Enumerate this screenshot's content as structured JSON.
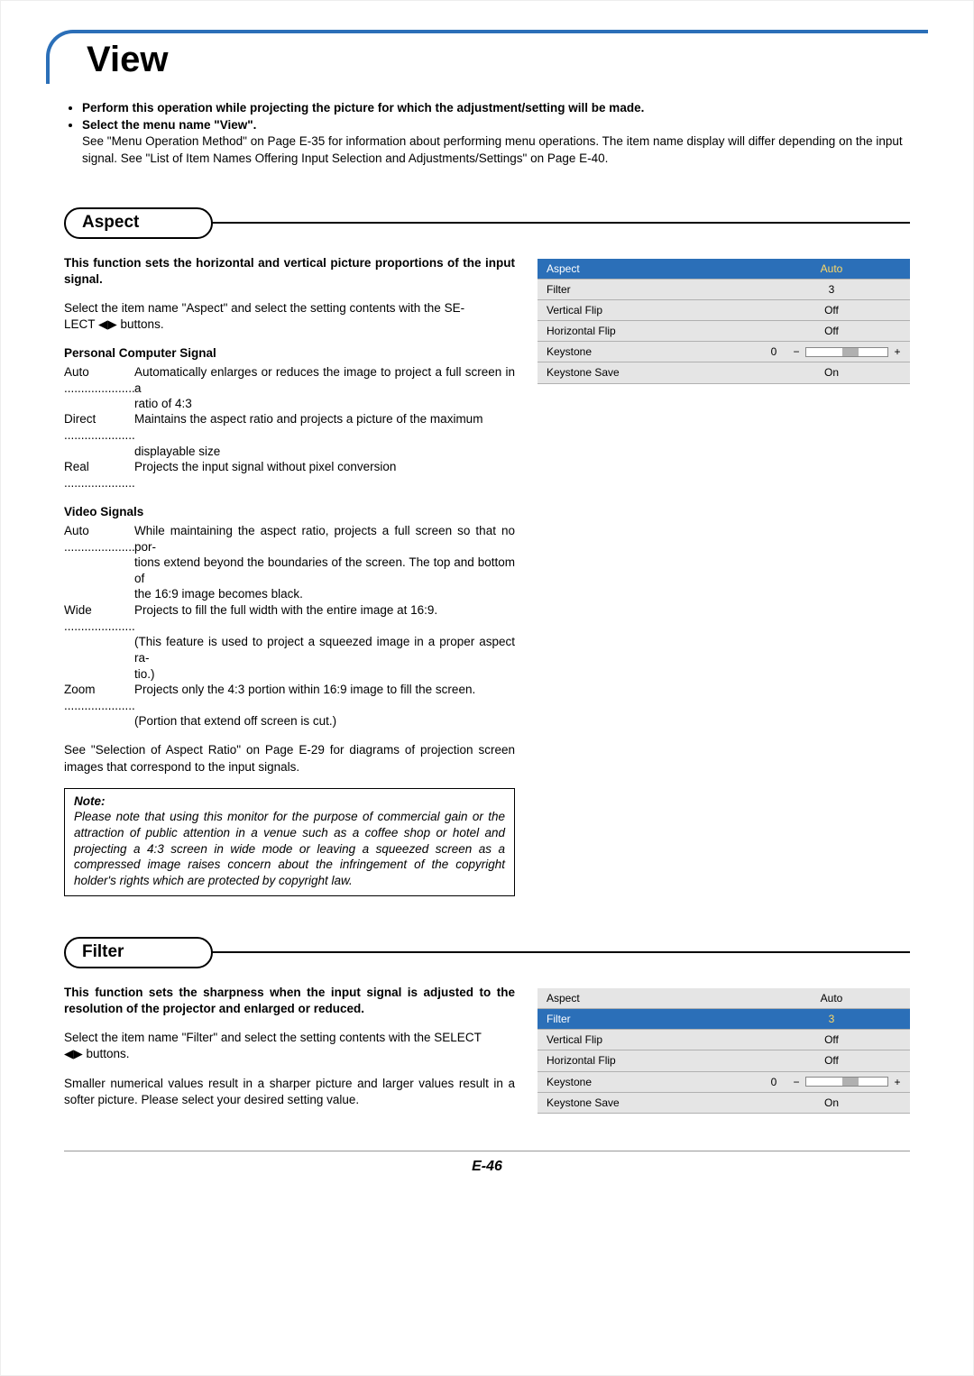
{
  "pageTitle": "View",
  "intro": {
    "bullet1": "Perform this operation while projecting the picture for which the adjustment/setting will be made.",
    "bullet2": "Select the menu name \"View\".",
    "text": "See \"Menu Operation Method\" on Page E-35 for information about performing menu operations. The item name display will differ depending on the input signal. See \"List of Item Names Offering Input Selection and Adjustments/Settings\" on Page E-40."
  },
  "sections": {
    "aspect": {
      "heading": "Aspect",
      "intro": "This function sets the horizontal and vertical picture proportions of the input signal.",
      "instruction_a": "Select the item name \"Aspect\" and select the setting contents with the SE-",
      "instruction_b": "LECT ◀▶ buttons.",
      "pc_head": "Personal Computer Signal",
      "pc_auto_label": "Auto",
      "pc_auto_text_a": "Automatically enlarges or reduces the image to project a full screen in a",
      "pc_auto_text_b": "ratio of 4:3",
      "pc_direct_label": "Direct",
      "pc_direct_text_a": "Maintains the aspect ratio and projects a picture of the maximum",
      "pc_direct_text_b": "displayable size",
      "pc_real_label": "Real",
      "pc_real_text": "Projects the input signal without pixel conversion",
      "vid_head": "Video Signals",
      "vid_auto_label": "Auto",
      "vid_auto_text_a": "While maintaining the aspect ratio, projects a full screen so that no por-",
      "vid_auto_text_b": "tions extend beyond the boundaries of the screen. The top and bottom of",
      "vid_auto_text_c": "the 16:9 image becomes black.",
      "vid_wide_label": "Wide",
      "vid_wide_text_a": "Projects to fill the full width with the entire image at 16:9.",
      "vid_wide_text_b": "(This feature is used to project a squeezed image in a proper aspect ra-",
      "vid_wide_text_c": "tio.)",
      "vid_zoom_label": "Zoom",
      "vid_zoom_text_a": "Projects only the 4:3 portion within 16:9 image to fill the screen.",
      "vid_zoom_text_b": "(Portion that extend off screen is cut.)",
      "see_also": "See \"Selection of Aspect Ratio\" on Page E-29 for diagrams of projection screen images that correspond to the input signals.",
      "note_label": "Note:",
      "note_text": "Please note that using this monitor for the purpose of commercial gain or the attraction of public attention in a venue such as a coffee shop or hotel and projecting a 4:3 screen in wide mode or leaving a squeezed screen as a compressed image raises concern about the infringement of the copyright holder's rights which are protected by copyright law."
    },
    "filter": {
      "heading": "Filter",
      "intro": "This function sets the sharpness when the input signal is adjusted to the resolution of the projector and enlarged or reduced.",
      "instruction_a": "Select the item name \"Filter\" and select the setting contents with the SELECT",
      "instruction_b": "◀▶ buttons.",
      "result": "Smaller numerical values result in a sharper picture and larger values result in a softer picture. Please select your desired setting value."
    }
  },
  "menu": {
    "rows": [
      {
        "label": "Aspect",
        "value": "Auto"
      },
      {
        "label": "Filter",
        "value": "3"
      },
      {
        "label": "Vertical Flip",
        "value": "Off"
      },
      {
        "label": "Horizontal Flip",
        "value": "Off"
      },
      {
        "label": "Keystone",
        "value": "0"
      },
      {
        "label": "Keystone Save",
        "value": "On"
      }
    ],
    "slider_minus": "−",
    "slider_plus": "+"
  },
  "pageNumber": "E-46"
}
